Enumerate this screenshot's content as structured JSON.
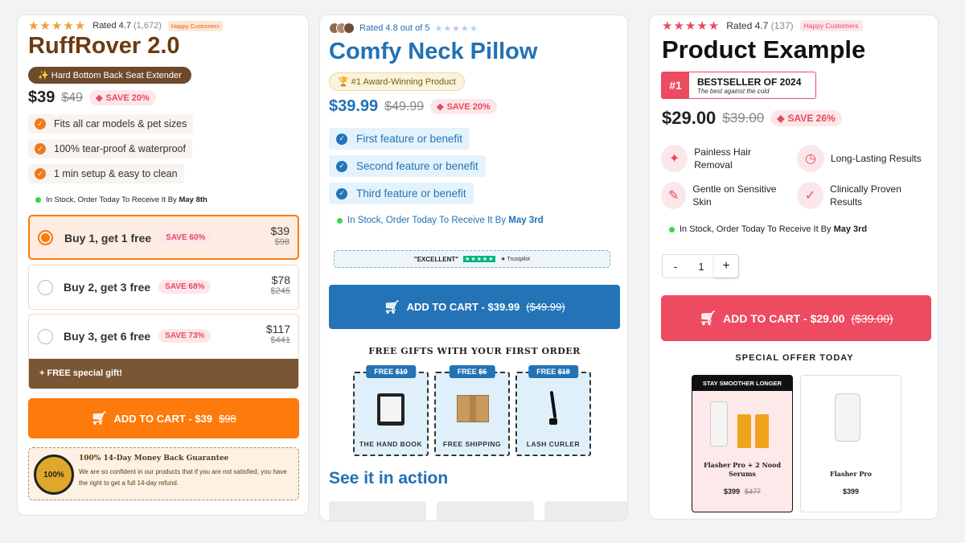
{
  "card1": {
    "stars": "★★★★★",
    "rating": "Rated 4.7",
    "count": "(1,672)",
    "happy": "Happy Customers",
    "title": "RuffRover 2.0",
    "badge": "✨ Hard Bottom Back Seat Extender",
    "price": "$39",
    "old_price": "$49",
    "save": "SAVE 20%",
    "features": [
      "Fits all car models & pet sizes",
      "100% tear-proof & waterproof",
      "1 min setup & easy to clean"
    ],
    "stock_prefix": "In Stock, Order Today To Receive It By ",
    "stock_date": "May 8th",
    "bundles": [
      {
        "label": "Buy 1, get 1 free",
        "save": "SAVE 60%",
        "price": "$39",
        "old": "$98"
      },
      {
        "label": "Buy 2, get 3 free",
        "save": "SAVE 68%",
        "price": "$78",
        "old": "$245"
      },
      {
        "label": "Buy 3, get 6 free",
        "save": "SAVE 73%",
        "price": "$117",
        "old": "$441"
      }
    ],
    "free_gift": "+ FREE special gift!",
    "cta": "ADD TO CART - $39",
    "cta_old": "$98",
    "guarantee_title": "100% 14-Day Money Back Guarantee",
    "guarantee_text": "We are so confident in our products that if you are not satisfied, you have the right to get a full 14-day refund.",
    "seal_text": "100%"
  },
  "card2": {
    "rating": "Rated 4.8 out of 5",
    "stars": "★★★★★",
    "title": "Comfy Neck Pillow",
    "award": "🏆 #1 Award-Winning Product",
    "price": "$39.99",
    "old_price": "$49.99",
    "save": "SAVE 20%",
    "features": [
      "First feature or benefit",
      "Second feature or benefit",
      "Third feature or benefit"
    ],
    "stock_prefix": "In Stock, Order Today To Receive It By ",
    "stock_date": "May 3rd",
    "trust_excellent": "\"EXCELLENT\"",
    "trust_stars": "★★★★★",
    "trust_brand": "★ Trustpilot",
    "cta": "ADD TO CART - $39.99",
    "cta_old": "($49.99)",
    "gifts_heading": "FREE GIFTS WITH YOUR FIRST ORDER",
    "gifts": [
      {
        "tag_prefix": "FREE ",
        "tag_old": "$10",
        "name": "THE HAND BOOK"
      },
      {
        "tag_prefix": "FREE ",
        "tag_old": "$6",
        "name": "FREE SHIPPING"
      },
      {
        "tag_prefix": "FREE ",
        "tag_old": "$19",
        "name": "LASH CURLER"
      }
    ],
    "section_title": "See it in action"
  },
  "card3": {
    "stars": "★★★★★",
    "rating": "Rated 4.7",
    "count": "(137)",
    "happy": "Happy Customers",
    "title": "Product Example",
    "best_num": "#1",
    "best_title": "BESTSELLER OF 2024",
    "best_sub": "The best against the cold",
    "price": "$29.00",
    "old_price": "$39.00",
    "save": "SAVE 26%",
    "features": [
      {
        "icon": "sparkle-icon",
        "glyph": "✦",
        "text": "Painless Hair Removal"
      },
      {
        "icon": "clock-icon",
        "glyph": "◷",
        "text": "Long-Lasting Results"
      },
      {
        "icon": "wand-icon",
        "glyph": "✎",
        "text": "Gentle on Sensitive Skin"
      },
      {
        "icon": "badge-check-icon",
        "glyph": "✓",
        "text": "Clinically Proven Results"
      }
    ],
    "stock_prefix": "In Stock, Order Today To Receive It By ",
    "stock_date": "May 3rd",
    "qty_minus": "-",
    "qty_value": "1",
    "qty_plus": "+",
    "cta": "ADD TO CART - $29.00",
    "cta_old": "($39.00)",
    "offer_heading": "SPECIAL OFFER TODAY",
    "offers": [
      {
        "ribbon": "STAY SMOOTHER LONGER",
        "name": "Flasher Pro + 2 Nood Serums",
        "price": "$399",
        "old": "$477"
      },
      {
        "ribbon": "",
        "name": "Flasher Pro",
        "price": "$399",
        "old": ""
      }
    ]
  },
  "colors": {
    "orange": "#fd7a0c",
    "brown": "#6e4a2c",
    "blue": "#2171b5",
    "pink": "#ee4a60"
  }
}
